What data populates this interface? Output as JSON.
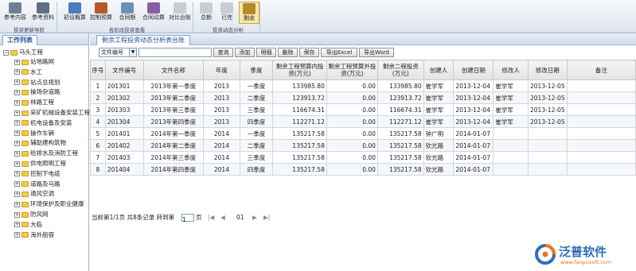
{
  "toolbar": {
    "groups": [
      {
        "caption": "投资更新导航",
        "buttons": [
          "参考内容",
          "参考资料"
        ]
      },
      {
        "caption": "各阶段投资查看",
        "buttons": [
          "初设概算",
          "控制预算",
          "合同额",
          "合同动算",
          "对比台账"
        ]
      },
      {
        "caption": "投资动态分析",
        "buttons": [
          "总额",
          "已完",
          "剩余"
        ]
      }
    ],
    "active_button": "剩余"
  },
  "sidebar": {
    "tab": "工作列表",
    "root": "马头工程",
    "items": [
      "站地路网",
      "水工",
      "站点总规划",
      "操场杂道路",
      "林路工程",
      "采矿机械设备安装工程",
      "机电设备及安装",
      "操作车辆",
      "辅助建构筑物",
      "给排水及消防工程",
      "供电照明工程",
      "控制下电缆",
      "道路及马路",
      "通风空调",
      "环境保护及职业健康",
      "防风网",
      "大临",
      "海外船宿"
    ]
  },
  "main": {
    "title": "剩余工程投资动态分析表台账",
    "filter": {
      "field": "文件编号",
      "search_value": ""
    },
    "actions": [
      "查询",
      "添加",
      "明细",
      "删除",
      "保存",
      "导出Excel",
      "导出Word"
    ],
    "table": {
      "headers": [
        "序号",
        "文件编号",
        "文件名称",
        "年度",
        "季度",
        "剩余工程预算内投资(万元)",
        "剩余工程预算外投资(万元)",
        "剩余二程投资(万元)",
        "创建人",
        "创建日期",
        "修改人",
        "修改日期",
        "备注"
      ],
      "rows": [
        [
          "1",
          "201301",
          "2013年第一季度",
          "2013",
          "一季度",
          "133985.80",
          "0.00",
          "133985.80",
          "崔学军",
          "2013-12-04",
          "崔学军",
          "2013-12-05",
          ""
        ],
        [
          "2",
          "201302",
          "2013年第二季度",
          "2013",
          "二季度",
          "123913.72",
          "0.00",
          "123913.72",
          "崔学军",
          "2013-12-04",
          "崔学军",
          "2013-12-05",
          ""
        ],
        [
          "3",
          "201303",
          "2013年第三季度",
          "2013",
          "三季度",
          "116674.31",
          "0.00",
          "116674.31",
          "崔学军",
          "2013-12-04",
          "崔学军",
          "2013-12-05",
          ""
        ],
        [
          "4",
          "201304",
          "2013年第四季度",
          "2013",
          "四季度",
          "112271.12",
          "0.00",
          "112271.12",
          "崔学军",
          "2013-12-04",
          "崔学军",
          "2013-12-05",
          ""
        ],
        [
          "5",
          "201401",
          "2014年第一季度",
          "2014",
          "一季度",
          "135217.58",
          "0.00",
          "135217.58",
          "钟广明",
          "2014-01-07",
          "",
          "",
          ""
        ],
        [
          "6",
          "201402",
          "2014年第二季度",
          "2014",
          "二季度",
          "135217.58",
          "0.00",
          "135217.58",
          "钦光路",
          "2014-01-07",
          "",
          "",
          ""
        ],
        [
          "7",
          "201403",
          "2014年第三季度",
          "2014",
          "三季度",
          "135217.58",
          "0.00",
          "135217.58",
          "钦光路",
          "2014-01-07",
          "",
          "",
          ""
        ],
        [
          "8",
          "201404",
          "2014年第四季度",
          "2014",
          "四季度",
          "135217.58",
          "0.00",
          "135217.58",
          "钦光路",
          "2014-01-07",
          "",
          "",
          ""
        ]
      ]
    },
    "pager": {
      "info": "当前第1/1页 共8条记录 转到第",
      "page_value": "1",
      "unit": "页",
      "current": "01"
    }
  },
  "logo": {
    "brand": "泛普软件",
    "url": "www.fanpusoft.com"
  },
  "colors": {
    "accent": "#1a4d94",
    "logo_orange": "#e8761e",
    "logo_blue": "#2a6fb8"
  }
}
